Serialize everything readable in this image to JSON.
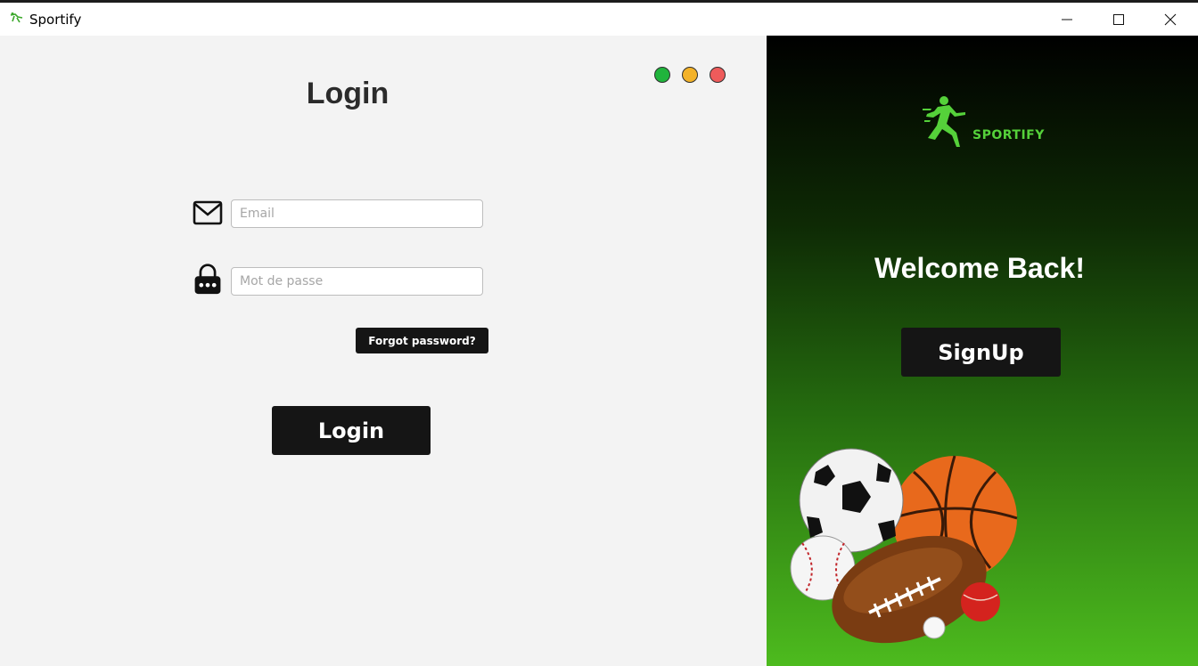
{
  "window": {
    "title": "Sportify",
    "controls": [
      "minimize",
      "maximize",
      "close"
    ]
  },
  "login_panel": {
    "heading": "Login",
    "traffic_lights": [
      "#20b43c",
      "#f3b229",
      "#ee5b5b"
    ],
    "email": {
      "placeholder": "Email",
      "value": "",
      "icon": "mail-icon"
    },
    "password": {
      "placeholder": "Mot de passe",
      "value": "",
      "icon": "lock-icon"
    },
    "forgot_label": "Forgot password?",
    "login_label": "Login"
  },
  "welcome_panel": {
    "logo_text": "SPORTIFY",
    "welcome_text": "Welcome Back!",
    "signup_label": "SignUp",
    "illustration": "sports-balls-illustration"
  },
  "colors": {
    "left_bg": "#f3f3f3",
    "button_bg": "#151515",
    "brand_green": "#55d13a",
    "gradient": [
      "#000000",
      "#0e2a05",
      "#256c0f",
      "#4dbb1e"
    ]
  }
}
